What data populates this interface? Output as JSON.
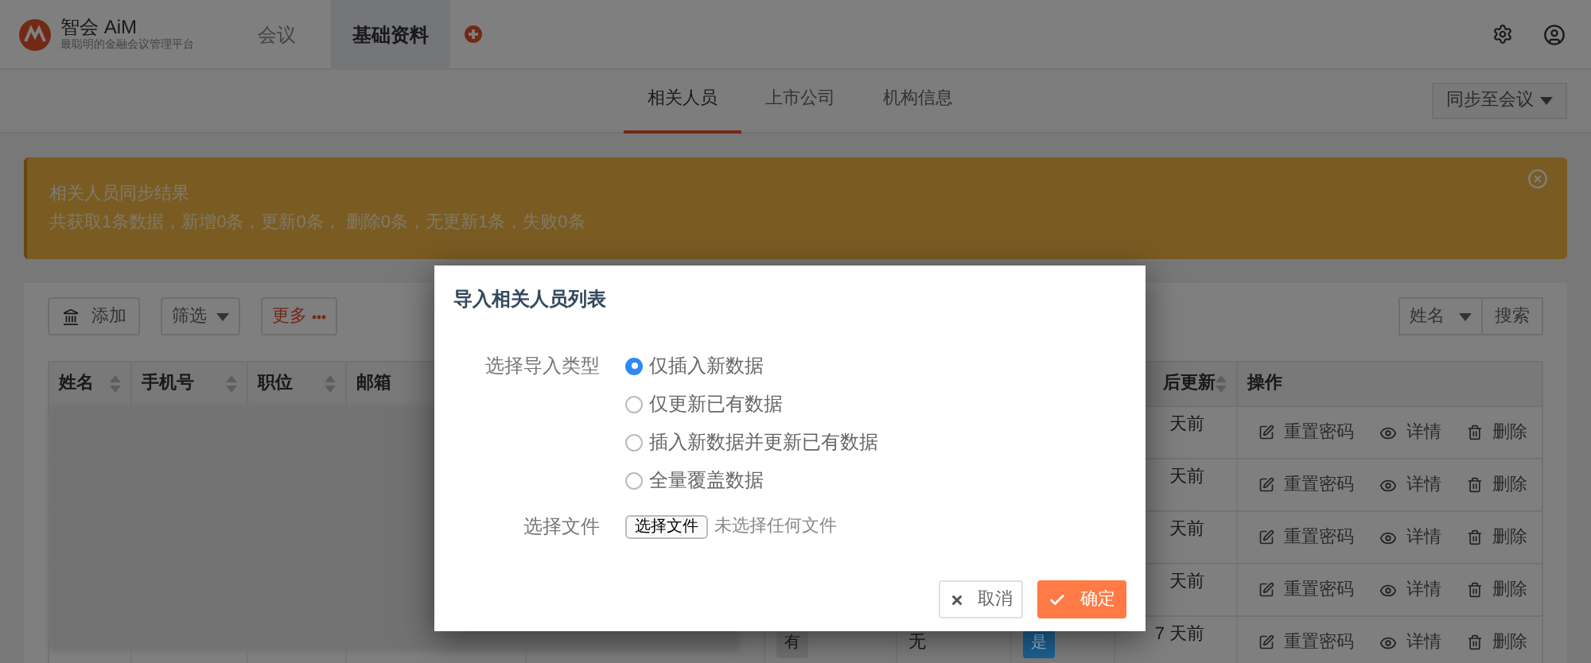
{
  "app": {
    "title": "智会 AiM",
    "subtitle": "最聪明的金融会议管理平台"
  },
  "nav": [
    {
      "label": "会议",
      "selected": false
    },
    {
      "label": "基础资料",
      "selected": true
    }
  ],
  "subtabs": [
    {
      "label": "相关人员",
      "selected": true
    },
    {
      "label": "上市公司",
      "selected": false
    },
    {
      "label": "机构信息",
      "selected": false
    }
  ],
  "sync_button": "同步至会议",
  "alert": {
    "title": "相关人员同步结果",
    "message": "共获取1条数据，新增0条，更新0条， 删除0条，无更新1条，失败0条"
  },
  "toolbar": {
    "add": "添加",
    "filter": "筛选",
    "more": "更多",
    "search_field": "姓名",
    "search": "搜索"
  },
  "table": {
    "columns": [
      {
        "label": "姓名",
        "sortable": true
      },
      {
        "label": "手机号",
        "sortable": true
      },
      {
        "label": "职位",
        "sortable": true
      },
      {
        "label": "邮箱",
        "sortable": false
      },
      null,
      null,
      null,
      null,
      {
        "label": "后更新",
        "sortable": true
      },
      {
        "label": "操作",
        "sortable": false
      }
    ],
    "rows": [
      {
        "updated": "天前",
        "actions": [
          "重置密码",
          "详情",
          "删除"
        ]
      },
      {
        "updated": "天前",
        "actions": [
          "重置密码",
          "详情",
          "删除"
        ]
      },
      {
        "updated": "天前",
        "actions": [
          "重置密码",
          "详情",
          "删除"
        ]
      },
      {
        "updated": "天前",
        "actions": [
          "重置密码",
          "详情",
          "删除"
        ]
      },
      {
        "cells": [
          {
            "text": "有",
            "kind": "tag",
            "color": "#747474"
          },
          {
            "text": "无",
            "kind": "text"
          },
          {
            "text": "是",
            "kind": "tag",
            "color": "#1c6396"
          }
        ],
        "updated": "7 天前",
        "actions": [
          "重置密码",
          "详情",
          "删除"
        ]
      }
    ]
  },
  "dialog": {
    "title": "导入相关人员列表",
    "fields": [
      {
        "label": "选择导入类型",
        "kind": "radio",
        "options": [
          {
            "label": "仅插入新数据",
            "selected": true
          },
          {
            "label": "仅更新已有数据",
            "selected": false
          },
          {
            "label": "插入新数据并更新已有数据",
            "selected": false
          },
          {
            "label": "全量覆盖数据",
            "selected": false
          }
        ]
      },
      {
        "label": "选择文件",
        "kind": "file",
        "button": "选择文件",
        "status": "未选择任何文件"
      }
    ],
    "buttons": [
      {
        "label": "取消",
        "kind": "secondary"
      },
      {
        "label": "确定",
        "kind": "primary"
      }
    ]
  }
}
